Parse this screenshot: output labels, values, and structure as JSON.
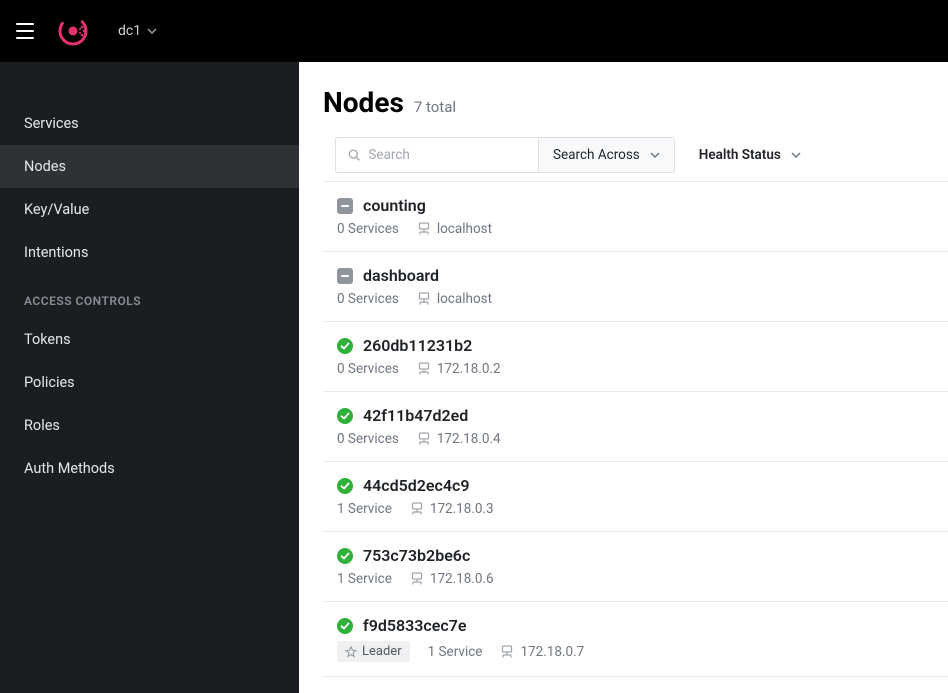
{
  "header": {
    "datacenter": "dc1"
  },
  "sidebar": {
    "items": [
      {
        "label": "Services",
        "active": false
      },
      {
        "label": "Nodes",
        "active": true
      },
      {
        "label": "Key/Value",
        "active": false
      },
      {
        "label": "Intentions",
        "active": false
      }
    ],
    "section_label": "ACCESS CONTROLS",
    "acl_items": [
      {
        "label": "Tokens"
      },
      {
        "label": "Policies"
      },
      {
        "label": "Roles"
      },
      {
        "label": "Auth Methods"
      }
    ]
  },
  "page": {
    "title": "Nodes",
    "subtitle": "7 total",
    "search_placeholder": "Search",
    "search_across_label": "Search Across",
    "health_filter_label": "Health Status"
  },
  "nodes": [
    {
      "status": "none",
      "name": "counting",
      "services": "0 Services",
      "address": "localhost",
      "leader": false
    },
    {
      "status": "none",
      "name": "dashboard",
      "services": "0 Services",
      "address": "localhost",
      "leader": false
    },
    {
      "status": "passing",
      "name": "260db11231b2",
      "services": "0 Services",
      "address": "172.18.0.2",
      "leader": false
    },
    {
      "status": "passing",
      "name": "42f11b47d2ed",
      "services": "0 Services",
      "address": "172.18.0.4",
      "leader": false
    },
    {
      "status": "passing",
      "name": "44cd5d2ec4c9",
      "services": "1 Service",
      "address": "172.18.0.3",
      "leader": false
    },
    {
      "status": "passing",
      "name": "753c73b2be6c",
      "services": "1 Service",
      "address": "172.18.0.6",
      "leader": false
    },
    {
      "status": "passing",
      "name": "f9d5833cec7e",
      "services": "1 Service",
      "address": "172.18.0.7",
      "leader": true
    }
  ],
  "leader_label": "Leader",
  "colors": {
    "brand": "#e6326c",
    "passing": "#2eb039"
  }
}
